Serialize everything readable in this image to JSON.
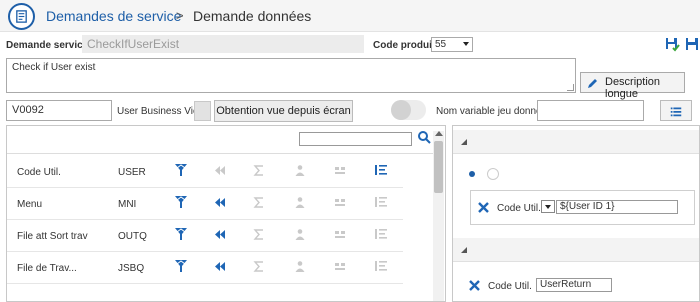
{
  "breadcrumb": {
    "root": "Demandes de service",
    "separator": ">",
    "current": "Demande données"
  },
  "form": {
    "demande_service_label": "Demande service",
    "demande_service_value": "CheckIfUserExist",
    "code_produit_label": "Code produit",
    "code_produit_value": "55",
    "description_value": "Check if User exist",
    "description_button": "Description longue",
    "business_view_value": "V0092",
    "business_view_label": "User Business View",
    "obtention_button": "Obtention vue depuis écran",
    "nom_variable_label": "Nom variable jeu données",
    "nom_variable_value": ""
  },
  "table": {
    "rows": [
      {
        "name": "Code Util.",
        "code": "USER",
        "left_arrows_active": false
      },
      {
        "name": "Menu",
        "code": "MNI",
        "left_arrows_active": true
      },
      {
        "name": "File att Sort trav",
        "code": "OUTQ",
        "left_arrows_active": true
      },
      {
        "name": "File de Trav...",
        "code": "JSBQ",
        "left_arrows_active": true
      }
    ]
  },
  "right_panel": {
    "condition_field_label": "Code Util.",
    "condition_value": "${User ID 1}",
    "return_field_label": "Code Util.",
    "return_value": "UserReturn"
  },
  "colors": {
    "accent": "#1e5fa8",
    "icon_blue": "#1f66b5",
    "icon_disabled": "#c9c9c9",
    "save_green": "#3aa63a"
  },
  "icons": {
    "app": "form-document-icon",
    "save": "floppy-disk-icon",
    "save_as": "floppy-disk-check-icon",
    "edit": "pencil-icon",
    "list": "list-icon",
    "search": "search-icon"
  }
}
